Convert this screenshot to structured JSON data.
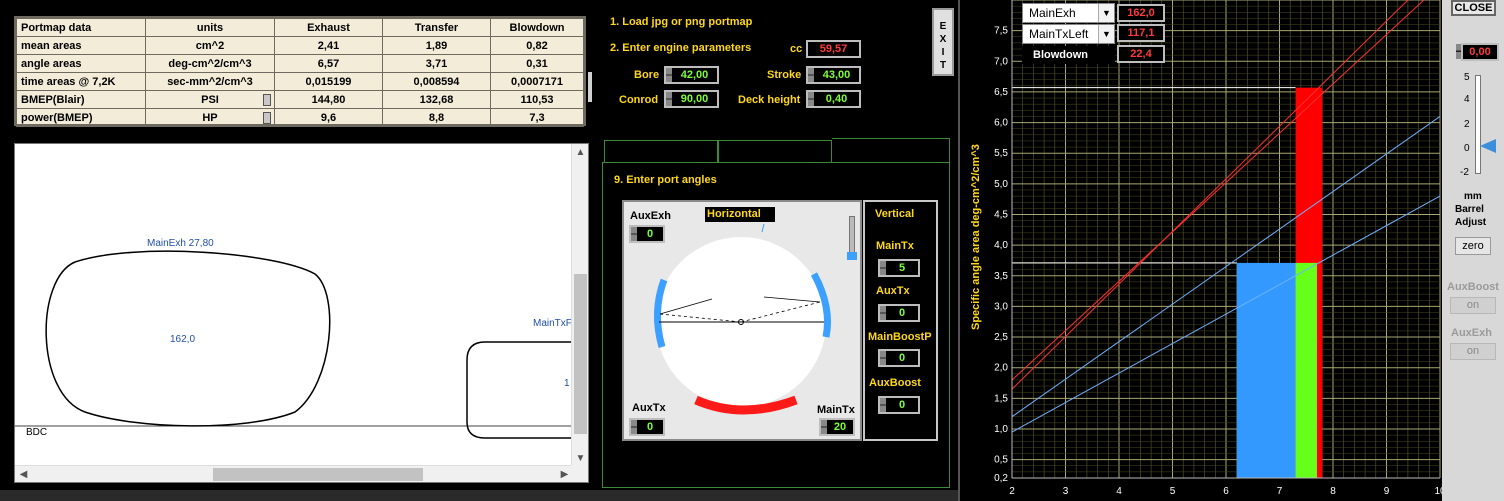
{
  "table": {
    "headers": [
      "Portmap data",
      "units",
      "Exhaust",
      "Transfer",
      "Blowdown"
    ],
    "rows": [
      {
        "label": "mean areas",
        "unit": "cm^2",
        "exhaust": "2,41",
        "transfer": "1,89",
        "blowdown": "0,82"
      },
      {
        "label": "angle areas",
        "unit": "deg-cm^2/cm^3",
        "exhaust": "6,57",
        "transfer": "3,71",
        "blowdown": "0,31"
      },
      {
        "label": "time areas @ 7,2K",
        "unit": "sec-mm^2/cm^3",
        "exhaust": "0,015199",
        "transfer": "0,008594",
        "blowdown": "0,0007171"
      },
      {
        "label": "BMEP(Blair)",
        "unit": "PSI",
        "exhaust": "144,80",
        "transfer": "132,68",
        "blowdown": "110,53"
      },
      {
        "label": "power(BMEP)",
        "unit": "HP",
        "exhaust": "9,6",
        "transfer": "8,8",
        "blowdown": "7,3"
      }
    ]
  },
  "portmap": {
    "exh_label": "MainExh 27,80",
    "exh_value": "162,0",
    "tx_label": "MainTxF",
    "tx_value": "1",
    "bdc_label": "BDC"
  },
  "steps": {
    "step1": "1. Load jpg or png portmap",
    "step2": "2. Enter engine parameters",
    "step9": "9. Enter port angles"
  },
  "engine": {
    "cc_label": "cc",
    "cc_value": "59,57",
    "bore_label": "Bore",
    "bore_value": "42,00",
    "stroke_label": "Stroke",
    "stroke_value": "43,00",
    "conrod_label": "Conrod",
    "conrod_value": "90,00",
    "deck_label": "Deck height",
    "deck_value": "0,40"
  },
  "exit_label": "EXIT",
  "angles": {
    "auxexh_label": "AuxExh",
    "auxexh_value": "0",
    "horizontal_label": "Horizontal",
    "auxtx_label": "AuxTx",
    "auxtx_value": "0",
    "maintx_label": "MainTx",
    "maintx_value": "20"
  },
  "vertical": {
    "title": "Vertical",
    "maintx_label": "MainTx",
    "maintx_value": "5",
    "auxtx_label": "AuxTx",
    "auxtx_value": "0",
    "mainboostp_label": "MainBoostP",
    "mainboostp_value": "0",
    "auxboost_label": "AuxBoost",
    "auxboost_value": "0"
  },
  "chart_controls": {
    "sel1_label": "MainExh",
    "sel1_value": "162,0",
    "sel2_label": "MainTxLeft",
    "sel2_value": "117,1",
    "blowdown_label": "Blowdown",
    "blowdown_value": "22,4"
  },
  "side": {
    "close_label": "CLOSE",
    "barrel_value": "0,00",
    "slider_ticks": [
      "5",
      "4",
      "2",
      "0",
      "-2"
    ],
    "slider_level": 0,
    "unit_label": "mm",
    "barrel_label": "Barrel",
    "adjust_label": "Adjust",
    "zero_label": "zero",
    "auxboost_label": "AuxBoost",
    "auxboost_btn": "on",
    "auxexh_label": "AuxExh",
    "auxexh_btn": "on"
  },
  "chart_data": {
    "type": "bar",
    "ylabel": "Specific angle area  deg-cm^2/cm^3",
    "xlim": [
      2,
      10
    ],
    "ylim": [
      0.2,
      8.0
    ],
    "x_ticks": [
      "2",
      "3",
      "4",
      "5",
      "6",
      "7",
      "8",
      "9",
      "10"
    ],
    "y_ticks": [
      "0,2",
      "0,5",
      "1,0",
      "1,5",
      "2,0",
      "2,5",
      "3,0",
      "3,5",
      "4,0",
      "4,5",
      "5,0",
      "5,5",
      "6,0",
      "6,5",
      "7,0",
      "7,5"
    ],
    "bars": [
      {
        "name": "Exhaust",
        "x0": 7.3,
        "x1": 7.8,
        "y": 6.57,
        "color": "#ff0000"
      },
      {
        "name": "Transfer",
        "x0": 6.2,
        "x1": 7.3,
        "y": 3.71,
        "color": "#3399ff"
      },
      {
        "name": "Blowdown",
        "x0": 7.3,
        "x1": 7.7,
        "y": 3.71,
        "color": "#66ff1a"
      }
    ],
    "ref_lines": [
      {
        "color": "#ff3030",
        "points": [
          [
            2,
            1.65
          ],
          [
            9.4,
            8.0
          ]
        ]
      },
      {
        "color": "#ff3030",
        "points": [
          [
            2,
            1.8
          ],
          [
            9.7,
            8.0
          ]
        ]
      },
      {
        "color": "#6fb0ff",
        "points": [
          [
            2,
            1.2
          ],
          [
            10,
            6.1
          ]
        ]
      },
      {
        "color": "#6fb0ff",
        "points": [
          [
            2,
            0.95
          ],
          [
            10,
            4.8
          ]
        ]
      }
    ],
    "h_markers": [
      6.57,
      3.71
    ]
  }
}
